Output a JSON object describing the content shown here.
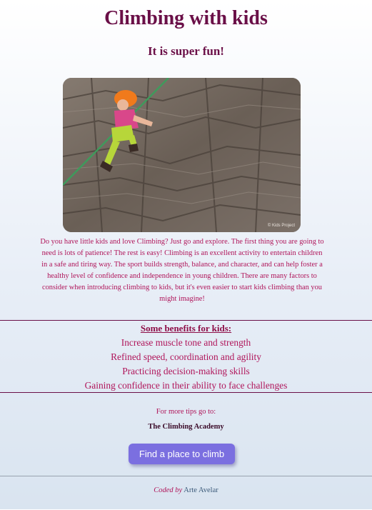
{
  "header": {
    "title": "Climbing with kids",
    "subtitle": "It is super fun!"
  },
  "photo": {
    "watermark": "© Kids Project",
    "accent_colors": {
      "helmet": "#f07a1c",
      "shirt": "#d9478a",
      "pants": "#b7d63a",
      "rope": "#3f9a5c",
      "rock": "#6e6258"
    }
  },
  "intro": {
    "text": "Do you have little kids and love Climbing? Just go and explore. The first thing you are going to need is lots of patience! The rest is easy! Climbing is an excellent activity to entertain children in a safe and tiring way. The sport builds strength, balance, and character, and can help foster a healthy level of confidence and independence in young children. There are many factors to consider when introducing climbing to kids, but it's even easier to start kids climbing than you might imagine!"
  },
  "benefits": {
    "title": "Some benefits for kids:",
    "items": [
      "Increase muscle tone and strength",
      "Refined speed, coordination and agility",
      "Practicing decision-making skills",
      "Gaining confidence in their ability to face challenges"
    ]
  },
  "tips": {
    "label": "For more tips go to:",
    "link": "The Climbing Academy"
  },
  "cta": {
    "label": "Find a place to climb",
    "color": "#7b6fe0"
  },
  "footer": {
    "coded_by": "Coded by",
    "author": "Arte Avelar"
  }
}
